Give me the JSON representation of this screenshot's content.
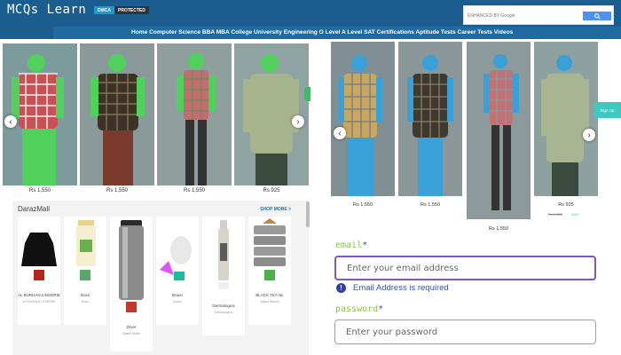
{
  "header": {
    "logo": "MCQs Learn",
    "dmca_badge": [
      "DMCA",
      "PROTECTED"
    ],
    "search": {
      "placeholder": "ENHANCED BY Google",
      "button_icon": "search-icon"
    },
    "nav": "Home Computer Science BBA MBA College University Engineering O Level A Level SAT Certifications Aptitude Tests Career Tests Videos"
  },
  "left_carousel": {
    "items": [
      {
        "price": "Rs 1,550",
        "color_shirt": "#c95055"
      },
      {
        "price": "Rs 1,550",
        "color_shirt": "#3d3226"
      },
      {
        "price": "Rs 1,550",
        "color_shirt": "#c26e6e"
      },
      {
        "price": "Rs 925",
        "color_shirt": "#a6b48e"
      }
    ],
    "prev_icon": "chevron-left-icon",
    "next_icon": "chevron-right-icon"
  },
  "daraz": {
    "title": "DarazMall",
    "shop_more": "SHOP MORE >",
    "items": [
      {
        "name": "AL BURHAN LINGERIE",
        "sub": "AL BURHAN LINGERIE"
      },
      {
        "name": "Boss",
        "sub": "Boss"
      },
      {
        "name": "Zilver",
        "sub": "Water Bottle"
      },
      {
        "name": "Braun",
        "sub": "Braun"
      },
      {
        "name": "Dermalogica",
        "sub": "Dermalogica"
      },
      {
        "name": "BLACK TEA NL",
        "sub": "Tastes Bakery"
      }
    ]
  },
  "right_carousel": {
    "items": [
      {
        "price": "Rs 1,550",
        "color_shirt": "#c8a860"
      },
      {
        "price": "Rs 1,550",
        "color_shirt": "#3e3a30"
      },
      {
        "price": "Rs 1,550",
        "color_shirt": "#c27272"
      },
      {
        "price": "Rs 925",
        "old_price": "Rs 1,850",
        "discount": "-50%",
        "color_shirt": "#a8b592"
      }
    ],
    "signup": "Sign Up"
  },
  "form": {
    "email_label": "email",
    "required_mark": "*",
    "email_placeholder": "Enter your email address",
    "email_error": "Email Address is required",
    "password_label": "password",
    "password_placeholder": "Enter your password",
    "accent": "#7e57c2",
    "error_color": "#3f51b5"
  }
}
